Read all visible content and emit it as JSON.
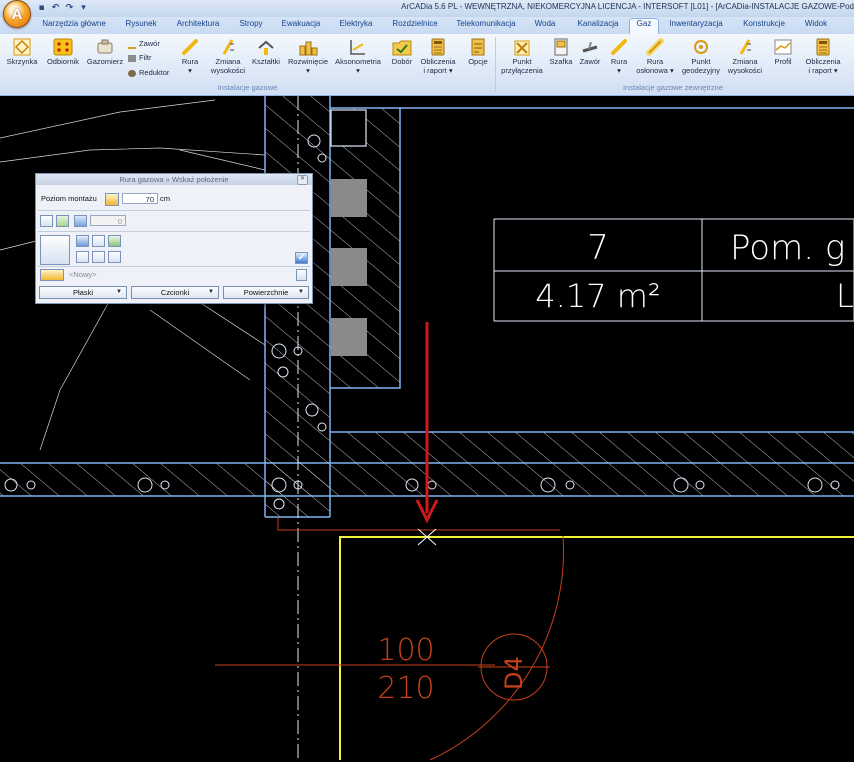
{
  "window": {
    "title": "ArCADia 5.6 PL - WEWNĘTRZNA, NIEKOMERCYJNA LICENCJA - INTERSOFT [L01] - [ArCADia-INSTALACJE GAZOWE-Pod"
  },
  "tabs": [
    {
      "label": "Narzędzia główne"
    },
    {
      "label": "Rysunek"
    },
    {
      "label": "Architektura"
    },
    {
      "label": "Stropy"
    },
    {
      "label": "Ewakuacja"
    },
    {
      "label": "Elektryka"
    },
    {
      "label": "Rozdzielnice"
    },
    {
      "label": "Telekomunikacja"
    },
    {
      "label": "Woda"
    },
    {
      "label": "Kanalizacja"
    },
    {
      "label": "Gaz"
    },
    {
      "label": "Inwentaryzacja"
    },
    {
      "label": "Konstrukcje"
    },
    {
      "label": "Widok"
    }
  ],
  "ribbon": {
    "group1": {
      "label": "Instalacje gazowe",
      "skrzynka": "Skrzynka",
      "odbiornik": "Odbiornik",
      "gazomierz": "Gazomierz",
      "zawor": "Zawór",
      "filtr": "Filtr",
      "reduktor": "Reduktor",
      "rura": "Rura",
      "zmiana_1": "Zmiana",
      "zmiana_2": "wysokości",
      "ksztaltki": "Kształtki",
      "rozwiniecie": "Rozwinięcie",
      "aksonometria": "Aksonometria",
      "dobor": "Dobór",
      "obliczenia_1": "Obliczenia",
      "obliczenia_2": "i raport",
      "opcje": "Opcje"
    },
    "group2": {
      "label": "Instalacje gazowe zewnętrzne",
      "punkt_1": "Punkt",
      "punkt_2": "przyłączenia",
      "szafka": "Szafka",
      "zawor": "Zawór",
      "rura": "Rura",
      "rura_o_1": "Rura",
      "rura_o_2": "osłonowa",
      "punkt_g_1": "Punkt",
      "punkt_g_2": "geodezyjny",
      "zmiana_1": "Zmiana",
      "zmiana_2": "wysokości",
      "profil": "Profil",
      "obliczenia_1": "Obliczenia",
      "obliczenia_2": "i raport"
    }
  },
  "panel": {
    "title": "Rura gazowa » Wskaż położenie",
    "poziom_label": "Poziom montażu",
    "poziom_value": "70",
    "poziom_unit": "cm",
    "angle_value": "0",
    "layer_value": "<Nowy>",
    "btn_plaski": "Płaski",
    "btn_czcionki": "Czcionki",
    "btn_powierzchnie": "Powierzchnie"
  },
  "drawing": {
    "room_number": "7",
    "room_name": "Pom. g",
    "room_area": "4.17 m²",
    "room_type": "L",
    "door_width": "100",
    "door_height": "210",
    "door_tag": "D4"
  },
  "colors": {
    "background": "#000000",
    "walls": "#7fb2f0",
    "hatch": "#dfe8f7",
    "room_outline": "#f2f23a",
    "door": "#c4401a",
    "arrow": "#d01818",
    "text_white": "#ffffff"
  }
}
